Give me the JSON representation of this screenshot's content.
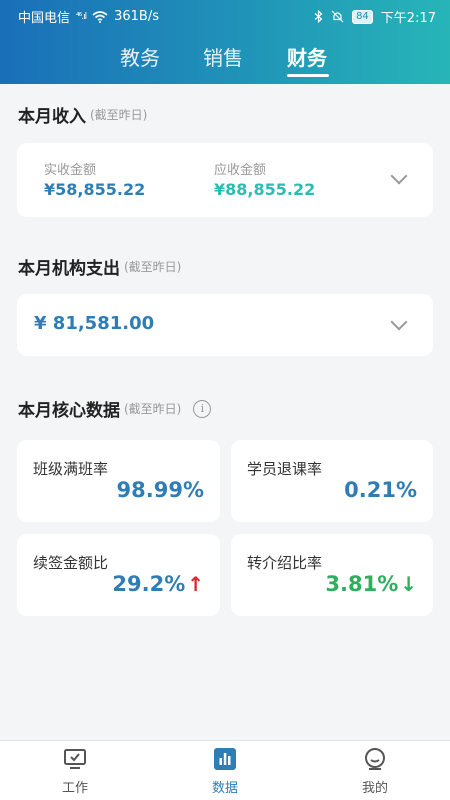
{
  "status": {
    "carrier": "中国电信",
    "signal": "⁴⁶.ıl",
    "speed": "361B/s",
    "battery": "84",
    "time": "下午2:17"
  },
  "tabs": [
    "教务",
    "销售",
    "财务"
  ],
  "income": {
    "title": "本月收入",
    "subtitle": "(截至昨日)",
    "actual_label": "实收金额",
    "actual_value": "¥58,855.22",
    "due_label": "应收金额",
    "due_value": "¥88,855.22"
  },
  "expense": {
    "title": "本月机构支出",
    "subtitle": "(截至昨日)",
    "value": "¥ 81,581.00"
  },
  "core": {
    "title": "本月核心数据",
    "subtitle": "(截至昨日)",
    "info": "i",
    "metrics": [
      {
        "label": "班级满班率",
        "value": "98.99%",
        "color": "#2f7db5"
      },
      {
        "label": "学员退课率",
        "value": "0.21%",
        "color": "#2f7db5"
      },
      {
        "label": "续签金额比",
        "value": "29.2%",
        "color": "#2f7db5",
        "trend": "up",
        "arrow": "↑"
      },
      {
        "label": "转介绍比率",
        "value": "3.81%",
        "color": "#2fae5c",
        "trend": "down",
        "arrow": "↓"
      }
    ]
  },
  "bottom_nav": [
    {
      "label": "工作",
      "icon": "monitor-check-icon"
    },
    {
      "label": "数据",
      "icon": "bar-chart-icon",
      "active": true
    },
    {
      "label": "我的",
      "icon": "profile-face-icon"
    }
  ],
  "colors": {
    "header_start": "#1a6fb8",
    "header_end": "#27b5b8",
    "accent_blue": "#2f7db5",
    "accent_teal": "#2bbdb3",
    "up_red": "#d72b2b",
    "down_green": "#2fae5c"
  }
}
